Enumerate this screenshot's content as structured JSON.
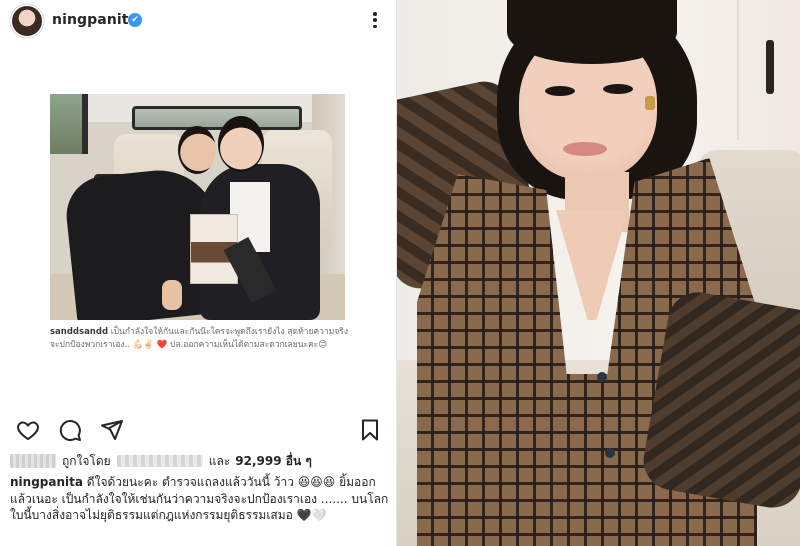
{
  "post": {
    "username": "ningpanita",
    "verified": "✔",
    "shared_caption": {
      "user": "sanddsandd",
      "text": "เป็นกำลังใจให้กันและกันน๊ะใครจะพูดถึงเรายังไง สุดท้ายความจริงจะปกป้องพวกเราเอง.. 💪🏻✌🏻",
      "heart": "❤️",
      "note": "ปล.ออกความเห็นได้ตามสะดวกเลยนะคะ😊"
    },
    "likes": {
      "prefix": "ถูกใจโดย",
      "and": "และ",
      "count": "92,999 อื่น ๆ"
    },
    "caption": {
      "user": "ningpanita",
      "text": "ดีใจด้วยนะคะ ตำรวจแถลงแล้ววันนี้ ว้าว 😆😆😆 ยิ้มออกแล้วเนอะ  เป็นกำลังใจให้เช่นกันว่าความจริงจะปกป้องเราเอง ....... บนโลกใบนี้บางสิ่งอาจไม่ยุติธรรมแต่กฎแห่งกรรมยุติธรรมเสมอ 🖤🤍"
    }
  }
}
